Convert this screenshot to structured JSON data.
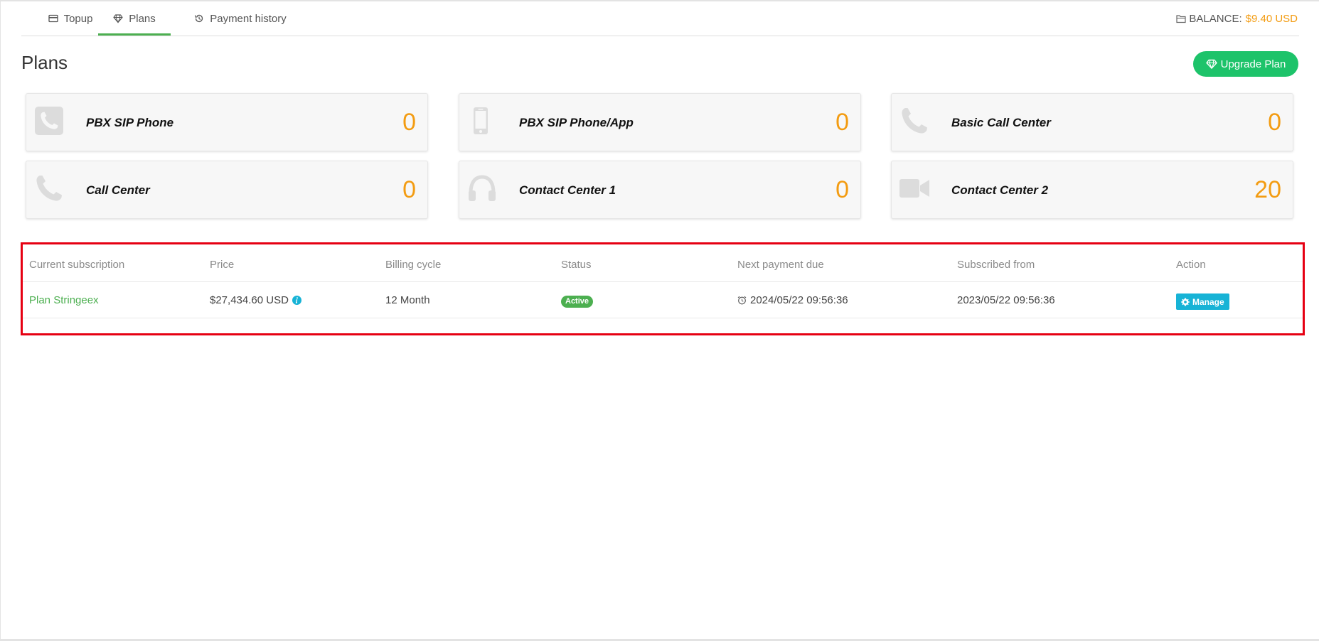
{
  "tabs": [
    {
      "label": "Topup",
      "icon": "credit-card-icon"
    },
    {
      "label": "Plans",
      "icon": "diamond-icon",
      "active": true
    },
    {
      "label": "Payment history",
      "icon": "history-icon"
    }
  ],
  "balance": {
    "label": "BALANCE:",
    "amount": "$9.40 USD",
    "icon": "folder-icon"
  },
  "header": {
    "title": "Plans",
    "upgrade_label": "Upgrade Plan"
  },
  "plans": [
    {
      "label": "PBX SIP Phone",
      "count": "0",
      "icon": "phone-icon"
    },
    {
      "label": "PBX SIP Phone/App",
      "count": "0",
      "icon": "mobile-icon"
    },
    {
      "label": "Basic Call Center",
      "count": "0",
      "icon": "phone-icon"
    },
    {
      "label": "Call Center",
      "count": "0",
      "icon": "phone-icon"
    },
    {
      "label": "Contact Center 1",
      "count": "0",
      "icon": "headphones-icon"
    },
    {
      "label": "Contact Center 2",
      "count": "20",
      "icon": "video-camera-icon"
    }
  ],
  "subscription": {
    "headers": [
      "Current subscription",
      "Price",
      "Billing cycle",
      "Status",
      "Next payment due",
      "Subscribed from",
      "Action"
    ],
    "row": {
      "plan": "Plan Stringeex",
      "price": "$27,434.60 USD",
      "billing_cycle": "12 Month",
      "status": "Active",
      "next_payment": "2024/05/22 09:56:36",
      "subscribed_from": "2023/05/22 09:56:36",
      "action": "Manage"
    }
  },
  "colors": {
    "accent_green": "#4caf50",
    "upgrade_green": "#1dc36a",
    "orange": "#f39c12",
    "info_blue": "#17b3d6",
    "highlight_red": "#e60012"
  }
}
